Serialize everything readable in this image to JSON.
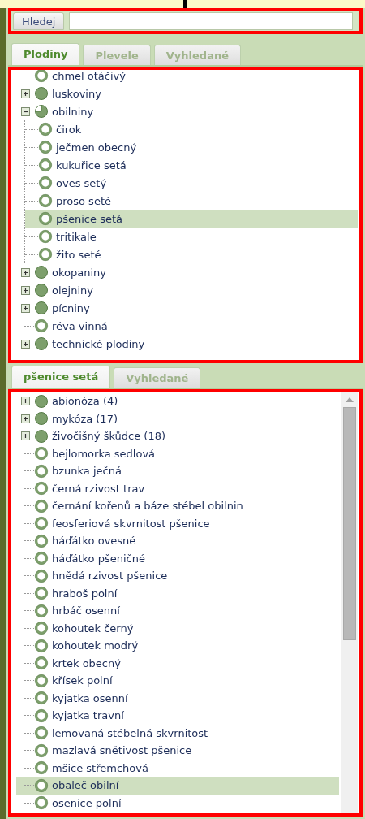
{
  "search": {
    "button_label": "Hledej"
  },
  "tabs": [
    {
      "label": "Plodiny",
      "selected": true
    },
    {
      "label": "Plevele",
      "selected": false
    },
    {
      "label": "Vyhledané",
      "selected": false
    }
  ],
  "tree": [
    {
      "label": "chmel otáčivý",
      "kind": "leaf",
      "selected": false
    },
    {
      "label": "luskoviny",
      "kind": "group",
      "expanded": false,
      "selected": false
    },
    {
      "label": "obilniny",
      "kind": "group",
      "expanded": true,
      "selected": false,
      "children": [
        {
          "label": "čirok",
          "kind": "leaf",
          "selected": false
        },
        {
          "label": "ječmen obecný",
          "kind": "leaf",
          "selected": false
        },
        {
          "label": "kukuřice setá",
          "kind": "leaf",
          "selected": false
        },
        {
          "label": "oves setý",
          "kind": "leaf",
          "selected": false
        },
        {
          "label": "proso seté",
          "kind": "leaf",
          "selected": false
        },
        {
          "label": "pšenice setá",
          "kind": "leaf",
          "selected": true
        },
        {
          "label": "tritikale",
          "kind": "leaf",
          "selected": false
        },
        {
          "label": "žito seté",
          "kind": "leaf",
          "selected": false
        }
      ]
    },
    {
      "label": "okopaniny",
      "kind": "group",
      "expanded": false,
      "selected": false
    },
    {
      "label": "olejniny",
      "kind": "group",
      "expanded": false,
      "selected": false
    },
    {
      "label": "pícniny",
      "kind": "group",
      "expanded": false,
      "selected": false
    },
    {
      "label": "réva vinná",
      "kind": "leaf",
      "selected": false
    },
    {
      "label": "technické plodiny",
      "kind": "group",
      "expanded": false,
      "selected": false
    }
  ],
  "detail_tabs": [
    {
      "label": "pšenice setá",
      "selected": true
    },
    {
      "label": "Vyhledané",
      "selected": false
    }
  ],
  "detail_tree": [
    {
      "label": "abionóza (4)",
      "kind": "group",
      "expanded": false,
      "selected": false
    },
    {
      "label": "mykóza (17)",
      "kind": "group",
      "expanded": false,
      "selected": false
    },
    {
      "label": "živočišný škůdce (18)",
      "kind": "group",
      "expanded": false,
      "selected": false
    },
    {
      "label": "bejlomorka sedlová",
      "kind": "leaf",
      "selected": false
    },
    {
      "label": "bzunka ječná",
      "kind": "leaf",
      "selected": false
    },
    {
      "label": "černá rzivost trav",
      "kind": "leaf",
      "selected": false
    },
    {
      "label": "černání kořenů a báze stébel obilnin",
      "kind": "leaf",
      "selected": false
    },
    {
      "label": "feosferiová skvrnitost pšenice",
      "kind": "leaf",
      "selected": false
    },
    {
      "label": "háďátko ovesné",
      "kind": "leaf",
      "selected": false
    },
    {
      "label": "háďátko pšeničné",
      "kind": "leaf",
      "selected": false
    },
    {
      "label": "hnědá rzivost pšenice",
      "kind": "leaf",
      "selected": false
    },
    {
      "label": "hraboš polní",
      "kind": "leaf",
      "selected": false
    },
    {
      "label": "hrbáč osenní",
      "kind": "leaf",
      "selected": false
    },
    {
      "label": "kohoutek černý",
      "kind": "leaf",
      "selected": false
    },
    {
      "label": "kohoutek modrý",
      "kind": "leaf",
      "selected": false
    },
    {
      "label": "krtek obecný",
      "kind": "leaf",
      "selected": false
    },
    {
      "label": "křísek polní",
      "kind": "leaf",
      "selected": false
    },
    {
      "label": "kyjatka osenní",
      "kind": "leaf",
      "selected": false
    },
    {
      "label": "kyjatka travní",
      "kind": "leaf",
      "selected": false
    },
    {
      "label": "lemovaná stébelná skvrnitost",
      "kind": "leaf",
      "selected": false
    },
    {
      "label": "mazlavá snětivost pšenice",
      "kind": "leaf",
      "selected": false
    },
    {
      "label": "mšice střemchová",
      "kind": "leaf",
      "selected": false
    },
    {
      "label": "obaleč obilní",
      "kind": "leaf",
      "selected": true
    },
    {
      "label": "osenice polní",
      "kind": "leaf",
      "selected": false
    }
  ]
}
